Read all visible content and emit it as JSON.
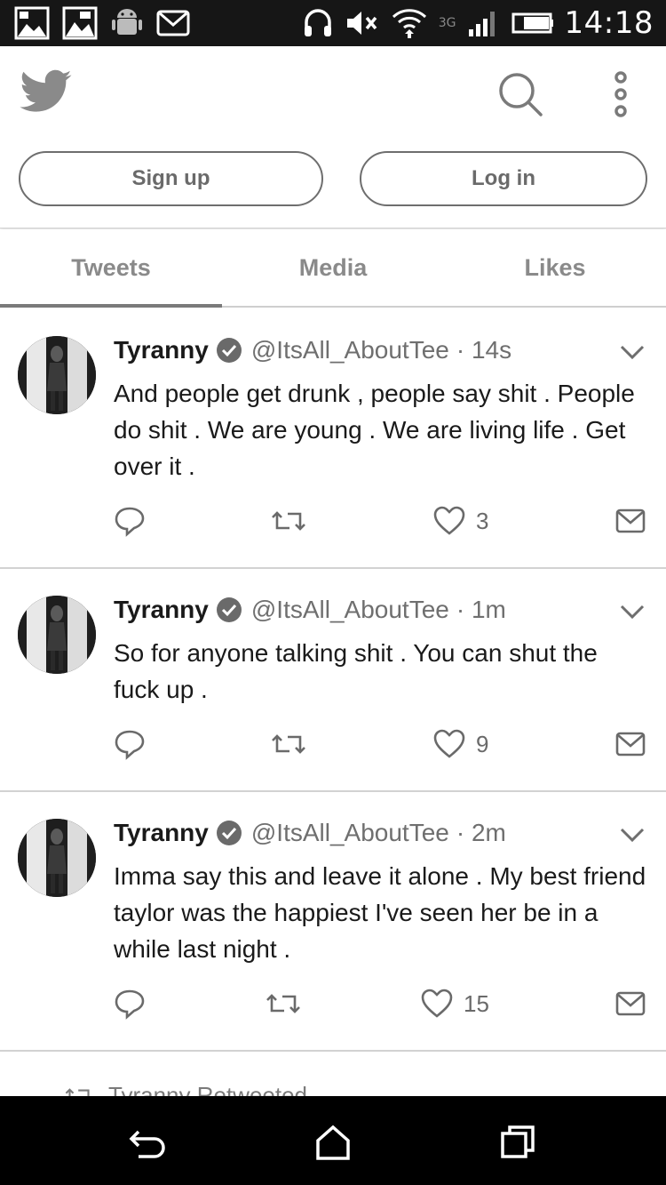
{
  "status_bar": {
    "time": "14:18",
    "network": "3G",
    "icons": [
      "image-icon",
      "image-icon",
      "android-icon",
      "gmail-icon",
      "headset-icon",
      "mute-icon",
      "wifi-icon",
      "signal-icon",
      "battery-icon"
    ]
  },
  "header": {
    "logo": "twitter-bird-icon",
    "signup_label": "Sign up",
    "login_label": "Log in"
  },
  "tabs": [
    {
      "label": "Tweets",
      "active": true
    },
    {
      "label": "Media",
      "active": false
    },
    {
      "label": "Likes",
      "active": false
    }
  ],
  "tweets": [
    {
      "name": "Tyranny",
      "handle": "@ItsAll_AboutTee",
      "time": "· 14s",
      "text": "And people get drunk , people say shit . People do shit . We are young . We are living life . Get over it .",
      "likes": "3"
    },
    {
      "name": "Tyranny",
      "handle": "@ItsAll_AboutTee",
      "time": "· 1m",
      "text": "So for anyone talking shit . You can shut the fuck up .",
      "likes": "9"
    },
    {
      "name": "Tyranny",
      "handle": "@ItsAll_AboutTee",
      "time": "· 2m",
      "text": "Imma say this and leave it alone . My best friend taylor was the happiest I've seen her be in a while last night .",
      "likes": "15"
    }
  ],
  "partial_item": {
    "label": "Tyranny Retweeted"
  },
  "colors": {
    "status_bar": "#161616",
    "nav_bar": "#000000",
    "accent": "#7a7a7a"
  }
}
